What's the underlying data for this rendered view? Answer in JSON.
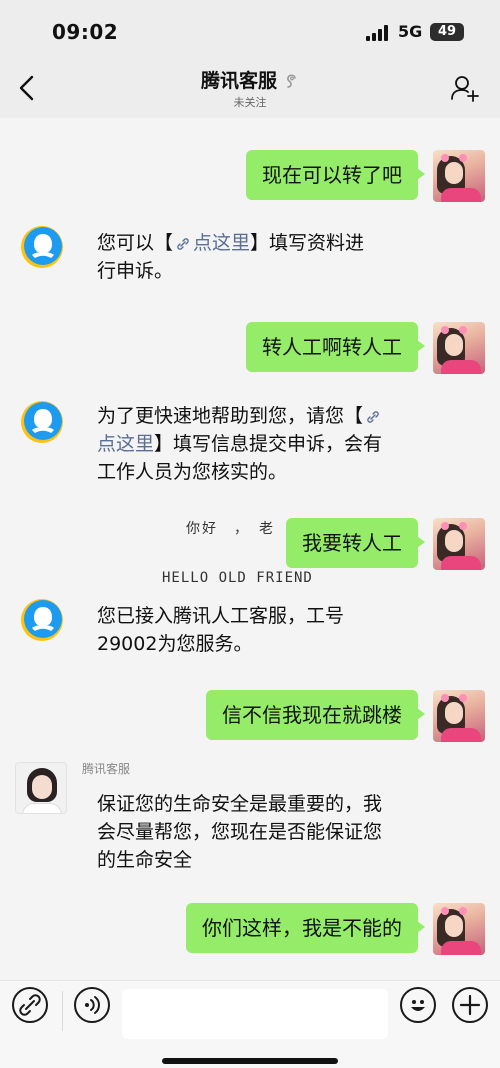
{
  "status_bar": {
    "time": "09:02",
    "network": "5G",
    "battery": "49"
  },
  "header": {
    "title": "腾讯客服",
    "subtitle": "未关注"
  },
  "messages": [
    {
      "side": "right",
      "text": "现在可以转了吧"
    },
    {
      "side": "left",
      "line1_pre": "您可以【",
      "link": "点这里",
      "line1_post": "】填写资料进",
      "line2": "行申诉。"
    },
    {
      "side": "right",
      "text": "转人工啊转人工"
    },
    {
      "side": "left",
      "line1_pre": "为了更快速地帮助到您，请您【",
      "line2_link": "点这里",
      "line2_post": "】填写信息提交申诉，会有",
      "line3": "工作人员为您核实的。"
    },
    {
      "side": "right",
      "text": "我要转人工"
    },
    {
      "side": "left",
      "line1": "您已接入腾讯人工客服，工号",
      "line2": "29002为您服务。"
    },
    {
      "side": "right",
      "text": "信不信我现在就跳楼"
    },
    {
      "side": "left",
      "sender": "腾讯客服",
      "line1": "保证您的生命安全是最重要的，我",
      "line2": "会尽量帮您，您现在是否能保证您",
      "line3": "的生命安全"
    },
    {
      "side": "right",
      "text": "你们这样，我是不能的"
    }
  ],
  "overlay_text": {
    "cn": "你好　，　老",
    "en": "HELLO  OLD  FRIEND"
  },
  "input": {
    "placeholder": ""
  },
  "colors": {
    "bubble_green": "#95ec69",
    "link": "#5a6e96",
    "qq_blue": "#1d9bf0",
    "qq_yellow": "#ffc20e"
  }
}
